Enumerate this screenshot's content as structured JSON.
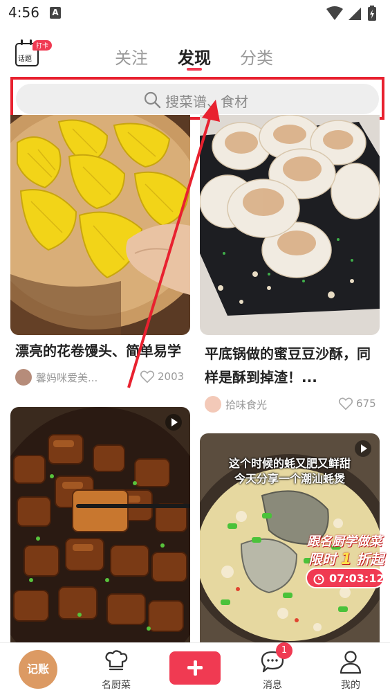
{
  "status_bar": {
    "time": "4:56",
    "notification_letter": "A"
  },
  "header": {
    "topic": {
      "label": "话题",
      "badge": "打卡",
      "icon": "calendar-icon"
    },
    "tabs": [
      {
        "label": "关注",
        "active": false
      },
      {
        "label": "发现",
        "active": true
      },
      {
        "label": "分类",
        "active": false
      }
    ],
    "accent_color": "#f03a52"
  },
  "search": {
    "placeholder": "搜菜谱、食材",
    "icon": "search-icon"
  },
  "feed": [
    {
      "title": "漂亮的花卷馒头、简单易学",
      "author": "馨妈咪爱美...",
      "likes": "2003",
      "video": false
    },
    {
      "title": "平底锅做的蜜豆豆沙酥，同样是酥到掉渣！...",
      "author": "拾味食光",
      "likes": "675",
      "video": false
    },
    {
      "title": "",
      "video": true
    },
    {
      "title": "",
      "video": true,
      "overlay_text": [
        "这个时候的蚝又肥又鲜甜",
        "今天分享一个潮汕蚝煲"
      ],
      "promo": {
        "line1": "跟名厨学做菜",
        "line2_prefix": "限时",
        "line2_number": "1",
        "line2_suffix": "折起",
        "timer": "07:03:12"
      }
    }
  ],
  "bottom_nav": {
    "items": [
      {
        "label": "记账"
      },
      {
        "label": "名厨菜",
        "icon": "chef-hat-icon"
      },
      {
        "label": "",
        "icon": "plus-icon"
      },
      {
        "label": "消息",
        "icon": "chat-bubble-icon",
        "badge": "1"
      },
      {
        "label": "我的",
        "icon": "user-icon"
      }
    ]
  }
}
